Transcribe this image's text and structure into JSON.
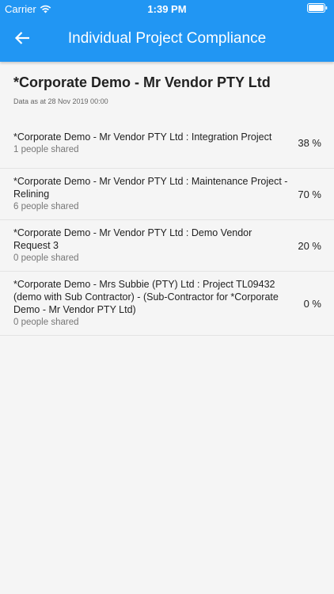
{
  "status_bar": {
    "carrier": "Carrier",
    "time": "1:39 PM"
  },
  "app_bar": {
    "title": "Individual Project Compliance",
    "back_icon": "arrow-left-icon",
    "color": "#2196f3"
  },
  "page": {
    "title": "*Corporate Demo - Mr Vendor PTY Ltd",
    "data_as_at": "Data as at 28 Nov 2019 00:00"
  },
  "projects": [
    {
      "name": "*Corporate Demo - Mr Vendor PTY Ltd : Integration Project",
      "shared": "1 people shared",
      "percent": "38 %"
    },
    {
      "name": "*Corporate Demo - Mr Vendor PTY Ltd : Maintenance Project - Relining",
      "shared": "6 people shared",
      "percent": "70 %"
    },
    {
      "name": "*Corporate Demo - Mr Vendor PTY Ltd : Demo Vendor Request 3",
      "shared": "0 people shared",
      "percent": "20 %"
    },
    {
      "name": "*Corporate Demo - Mrs Subbie (PTY) Ltd : Project TL09432  (demo with Sub Contractor) - (Sub-Contractor for *Corporate Demo - Mr Vendor PTY Ltd)",
      "shared": "0 people shared",
      "percent": "0 %"
    }
  ]
}
